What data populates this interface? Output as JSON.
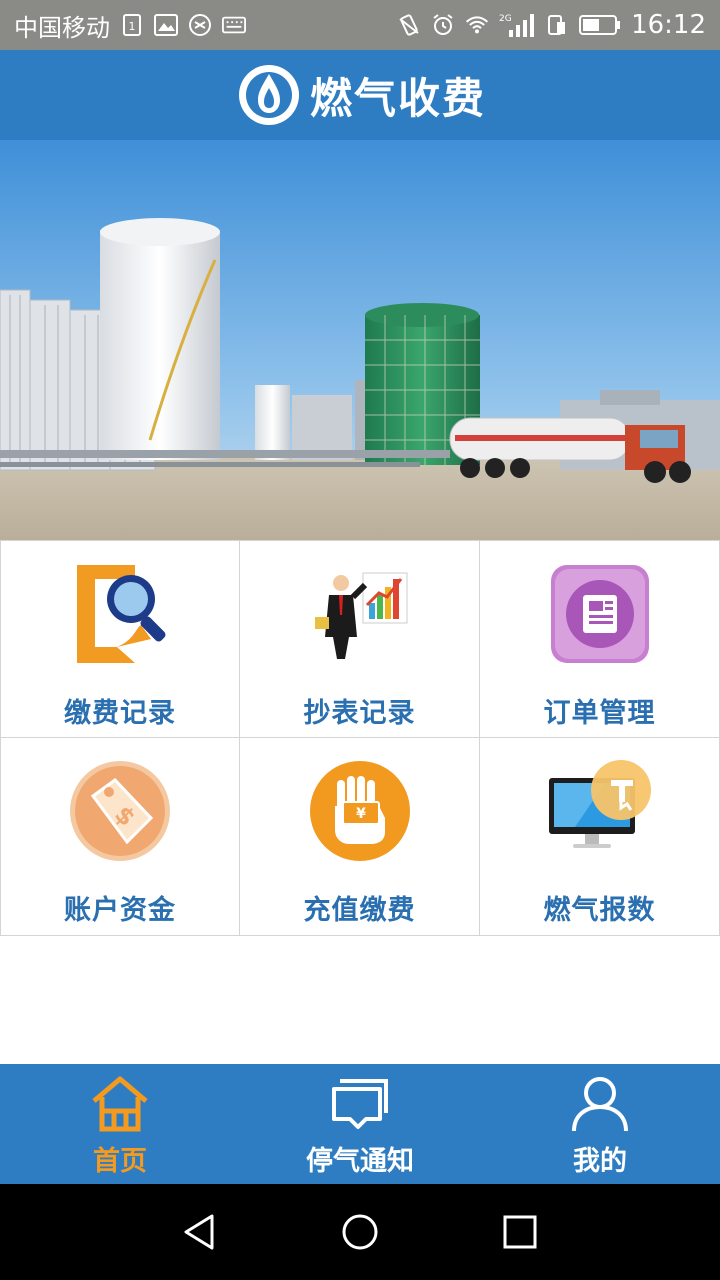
{
  "status_bar": {
    "carrier": "中国移动",
    "time": "16:12",
    "network": "2G",
    "icons": [
      "sim-icon",
      "image-icon",
      "location-icon",
      "keyboard-icon",
      "vibrate-icon",
      "alarm-icon",
      "wifi-icon",
      "signal-icon",
      "data-icon",
      "battery-icon"
    ]
  },
  "header": {
    "title": "燃气收费",
    "logo_icon": "flame-logo-icon"
  },
  "banner": {
    "image": "gas-station-photo"
  },
  "menu": [
    {
      "label": "缴费记录",
      "icon": "search-document-icon"
    },
    {
      "label": "抄表记录",
      "icon": "businessman-chart-icon"
    },
    {
      "label": "订单管理",
      "icon": "order-document-icon"
    },
    {
      "label": "账户资金",
      "icon": "price-tag-icon"
    },
    {
      "label": "充值缴费",
      "icon": "hand-money-icon"
    },
    {
      "label": "燃气报数",
      "icon": "monitor-touch-icon"
    }
  ],
  "bottom_nav": {
    "items": [
      {
        "label": "首页",
        "icon": "home-icon",
        "active": true
      },
      {
        "label": "停气通知",
        "icon": "message-icon",
        "active": false
      },
      {
        "label": "我的",
        "icon": "user-icon",
        "active": false
      }
    ],
    "active_color": "#f39a1f",
    "inactive_color": "#ffffff"
  },
  "colors": {
    "primary": "#2e7dc3",
    "label": "#2a6fb0",
    "status_bar": "#8a8a86"
  }
}
